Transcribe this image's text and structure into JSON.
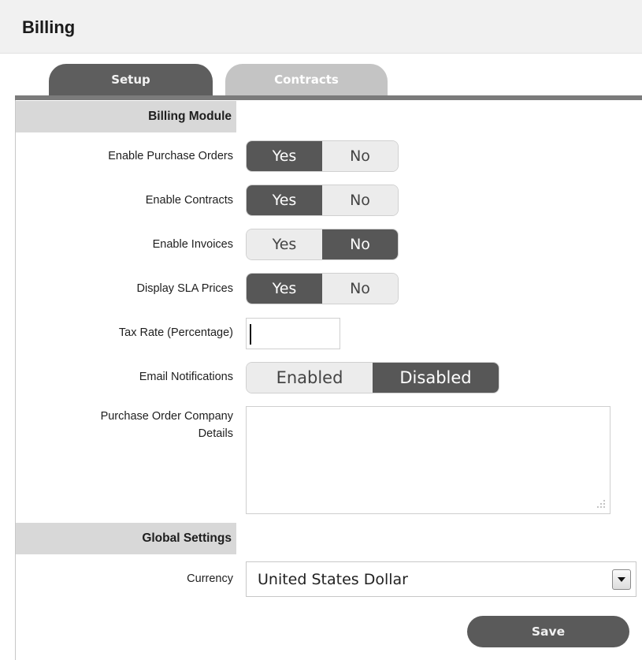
{
  "page": {
    "title": "Billing"
  },
  "tabs": [
    {
      "label": "Setup",
      "active": true
    },
    {
      "label": "Contracts",
      "active": false
    }
  ],
  "billing_module": {
    "heading": "Billing Module",
    "enable_purchase_orders": {
      "label": "Enable Purchase Orders",
      "options": [
        "Yes",
        "No"
      ],
      "selected": "Yes"
    },
    "enable_contracts": {
      "label": "Enable Contracts",
      "options": [
        "Yes",
        "No"
      ],
      "selected": "Yes"
    },
    "enable_invoices": {
      "label": "Enable Invoices",
      "options": [
        "Yes",
        "No"
      ],
      "selected": "No"
    },
    "display_sla_prices": {
      "label": "Display SLA Prices",
      "options": [
        "Yes",
        "No"
      ],
      "selected": "Yes"
    },
    "tax_rate": {
      "label": "Tax Rate (Percentage)",
      "value": ""
    },
    "email_notifications": {
      "label": "Email Notifications",
      "options": [
        "Enabled",
        "Disabled"
      ],
      "selected": "Disabled"
    },
    "po_company_details": {
      "label_line1": "Purchase Order Company",
      "label_line2": "Details",
      "value": ""
    }
  },
  "global_settings": {
    "heading": "Global Settings",
    "currency": {
      "label": "Currency",
      "value": "United States Dollar"
    }
  },
  "actions": {
    "save_label": "Save"
  },
  "icons": {
    "dropdown": "chevron-down-icon",
    "resize": "resize-grip-icon"
  },
  "colors": {
    "selected_toggle": "#575757",
    "unselected_toggle": "#ececec",
    "active_tab": "#5e5e5e",
    "inactive_tab": "#c4c4c4",
    "section_header": "#d8d8d8"
  }
}
